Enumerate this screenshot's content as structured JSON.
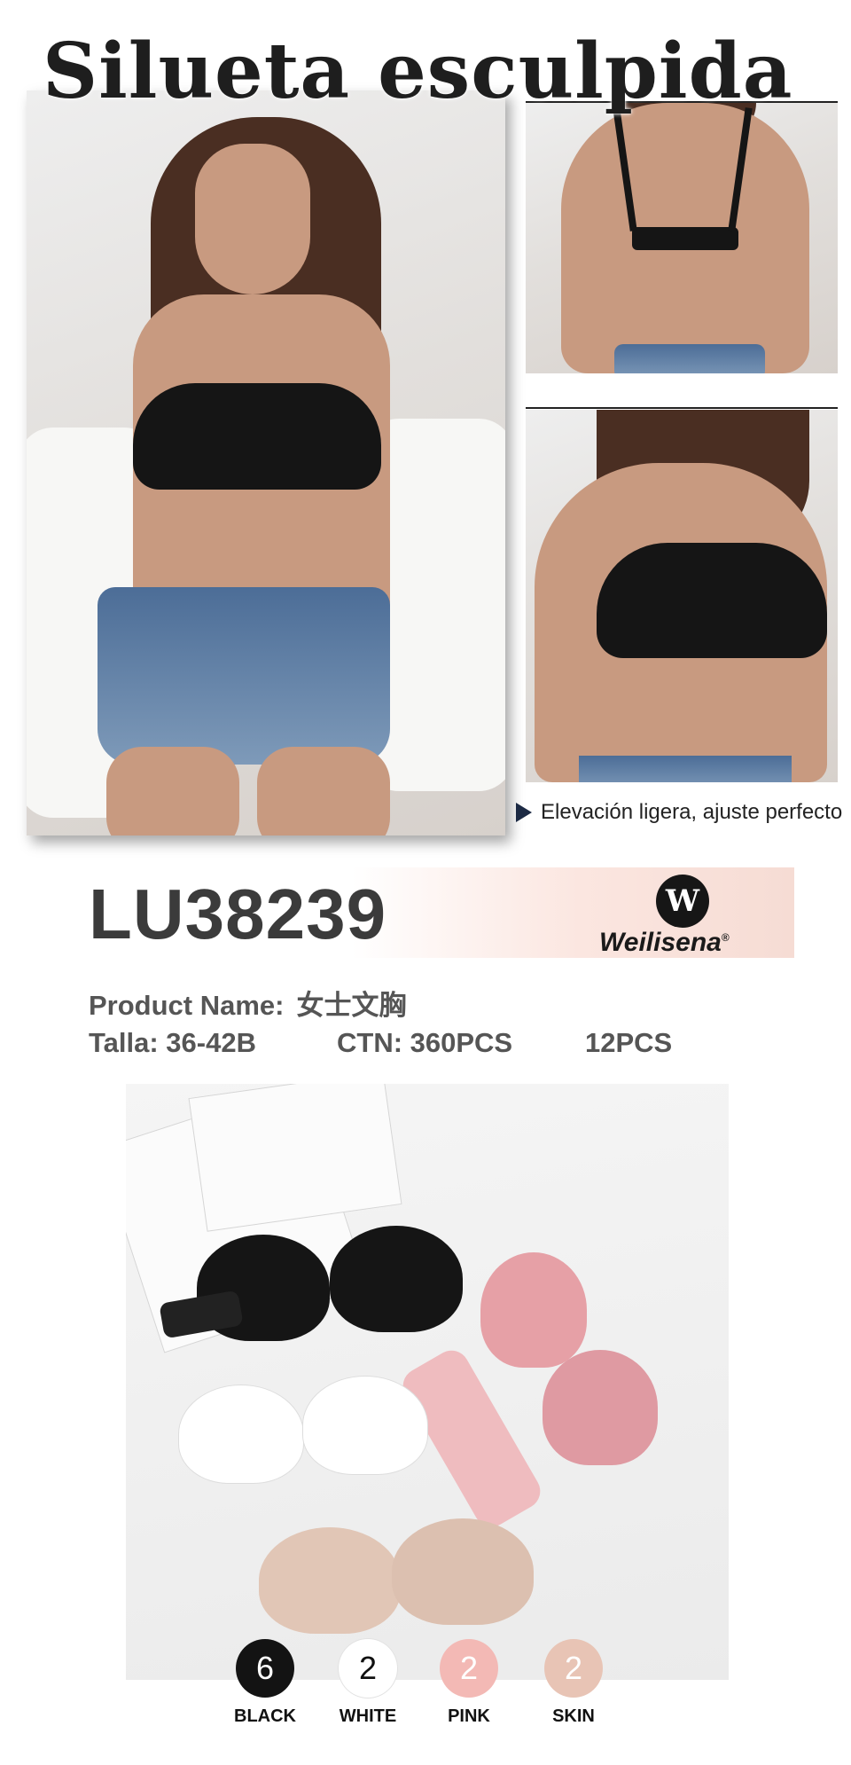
{
  "headline": "Silueta esculpida",
  "caption": "Elevación ligera, ajuste perfecto",
  "model_code": "LU38239",
  "brand": {
    "logo_letter": "W",
    "name": "Weilisena",
    "mark": "®"
  },
  "specs": {
    "product_name_label": "Product Name:",
    "product_name_value": "女士文胸",
    "size": "Talla: 36-42B",
    "carton": "CTN: 360PCS",
    "pack": "12PCS"
  },
  "colors": [
    {
      "count": "6",
      "name": "BLACK",
      "hex": "#131313"
    },
    {
      "count": "2",
      "name": "WHITE",
      "hex": "#ffffff"
    },
    {
      "count": "2",
      "name": "PINK",
      "hex": "#f3b9b5"
    },
    {
      "count": "2",
      "name": "SKIN",
      "hex": "#e8c4b5"
    }
  ]
}
